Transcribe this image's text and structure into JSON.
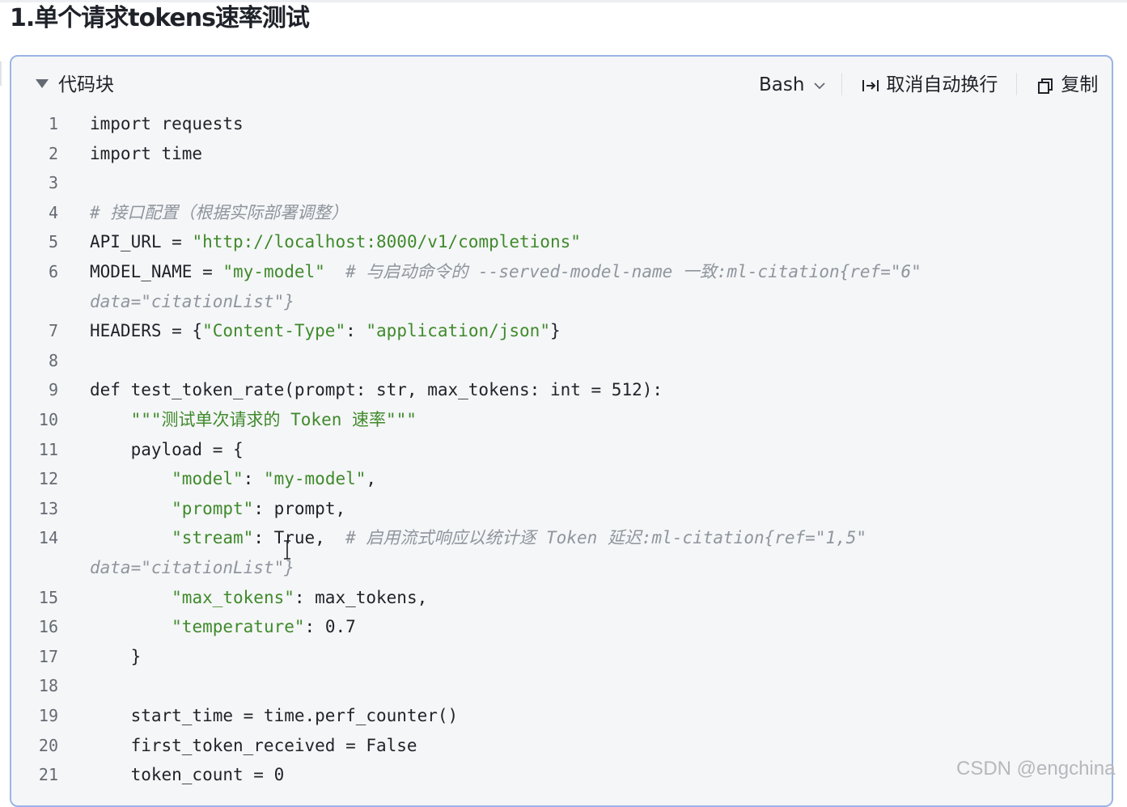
{
  "heading": "1.单个请求tokens速率测试",
  "codeblock": {
    "title": "代码块",
    "language": "Bash",
    "wrap_label": "取消自动换行",
    "copy_label": "复制"
  },
  "colors": {
    "string": "#3f8a2c",
    "comment": "#8f959e",
    "border": "#9ab4e6",
    "background": "#f5f6f7"
  },
  "code_lines": [
    {
      "n": "1",
      "segs": [
        {
          "t": "import requests",
          "c": ""
        }
      ]
    },
    {
      "n": "2",
      "segs": [
        {
          "t": "import time",
          "c": ""
        }
      ]
    },
    {
      "n": "3",
      "segs": []
    },
    {
      "n": "4",
      "segs": [
        {
          "t": "# 接口配置（根据实际部署调整）",
          "c": "c"
        }
      ]
    },
    {
      "n": "5",
      "segs": [
        {
          "t": "API_URL = ",
          "c": ""
        },
        {
          "t": "\"http://localhost:8000/v1/completions\"",
          "c": "s"
        }
      ]
    },
    {
      "n": "6",
      "segs": [
        {
          "t": "MODEL_NAME = ",
          "c": ""
        },
        {
          "t": "\"my-model\"",
          "c": "s"
        },
        {
          "t": "  ",
          "c": ""
        },
        {
          "t": "# 与启动命令的 --served-model-name 一致:ml-citation{ref=\"6\"",
          "c": "c"
        }
      ],
      "wrap": "data=\"citationList\"}"
    },
    {
      "n": "7",
      "segs": [
        {
          "t": "HEADERS = {",
          "c": ""
        },
        {
          "t": "\"Content-Type\"",
          "c": "s"
        },
        {
          "t": ": ",
          "c": ""
        },
        {
          "t": "\"application/json\"",
          "c": "s"
        },
        {
          "t": "}",
          "c": ""
        }
      ]
    },
    {
      "n": "8",
      "segs": []
    },
    {
      "n": "9",
      "segs": [
        {
          "t": "def test_token_rate(prompt: str, max_tokens: int = 512):",
          "c": ""
        }
      ]
    },
    {
      "n": "10",
      "segs": [
        {
          "t": "    ",
          "c": ""
        },
        {
          "t": "\"\"\"测试单次请求的 Token 速率\"\"\"",
          "c": "s"
        }
      ]
    },
    {
      "n": "11",
      "segs": [
        {
          "t": "    payload = {",
          "c": ""
        }
      ]
    },
    {
      "n": "12",
      "segs": [
        {
          "t": "        ",
          "c": ""
        },
        {
          "t": "\"model\"",
          "c": "s"
        },
        {
          "t": ": ",
          "c": ""
        },
        {
          "t": "\"my-model\"",
          "c": "s"
        },
        {
          "t": ",",
          "c": ""
        }
      ]
    },
    {
      "n": "13",
      "segs": [
        {
          "t": "        ",
          "c": ""
        },
        {
          "t": "\"prompt\"",
          "c": "s"
        },
        {
          "t": ": prompt,",
          "c": ""
        }
      ]
    },
    {
      "n": "14",
      "segs": [
        {
          "t": "        ",
          "c": ""
        },
        {
          "t": "\"stream\"",
          "c": "s"
        },
        {
          "t": ": True,  ",
          "c": ""
        },
        {
          "t": "# 启用流式响应以统计逐 Token 延迟:ml-citation{ref=\"1,5\"",
          "c": "c"
        }
      ],
      "wrap": "data=\"citationList\"}"
    },
    {
      "n": "15",
      "segs": [
        {
          "t": "        ",
          "c": ""
        },
        {
          "t": "\"max_tokens\"",
          "c": "s"
        },
        {
          "t": ": max_tokens,",
          "c": ""
        }
      ]
    },
    {
      "n": "16",
      "segs": [
        {
          "t": "        ",
          "c": ""
        },
        {
          "t": "\"temperature\"",
          "c": "s"
        },
        {
          "t": ": 0.7",
          "c": ""
        }
      ]
    },
    {
      "n": "17",
      "segs": [
        {
          "t": "    }",
          "c": ""
        }
      ]
    },
    {
      "n": "18",
      "segs": []
    },
    {
      "n": "19",
      "segs": [
        {
          "t": "    start_time = time.perf_counter()",
          "c": ""
        }
      ]
    },
    {
      "n": "20",
      "segs": [
        {
          "t": "    first_token_received = False",
          "c": ""
        }
      ]
    },
    {
      "n": "21",
      "segs": [
        {
          "t": "    token_count = 0",
          "c": ""
        }
      ]
    }
  ],
  "watermark": "CSDN @engchina"
}
